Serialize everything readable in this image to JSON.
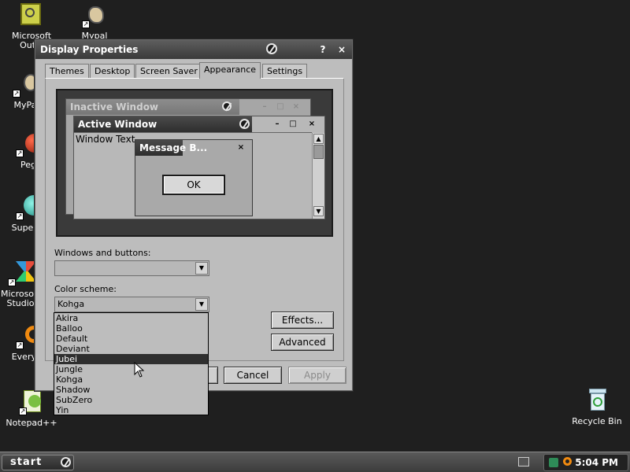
{
  "desktop": {
    "icons": [
      {
        "label": "Microsoft Outlook",
        "label_visible": "Microsoft\nOutlo"
      },
      {
        "label": "Mypal",
        "label_visible": "Mypal"
      },
      {
        "label": "MyPa",
        "label_visible": "MyPa"
      },
      {
        "label": "Peg",
        "label_visible": "Peg"
      },
      {
        "label": "Superm",
        "label_visible": "Superm"
      },
      {
        "label": "Microsoft Studio",
        "label_visible": "Microsoft\nStudio"
      },
      {
        "label": "Everyth",
        "label_visible": "Everyth"
      },
      {
        "label": "Notepad++",
        "label_visible": "Notepad++"
      },
      {
        "label": "Recycle Bin",
        "label_visible": "Recycle Bin"
      }
    ]
  },
  "dialog": {
    "title": "Display Properties",
    "help_label": "?",
    "close_label": "×",
    "tabs": [
      {
        "label": "Themes"
      },
      {
        "label": "Desktop"
      },
      {
        "label": "Screen Saver"
      },
      {
        "label": "Appearance",
        "active": true
      },
      {
        "label": "Settings"
      }
    ],
    "preview": {
      "inactive_title": "Inactive Window",
      "active_title": "Active Window",
      "window_text": "Window Text",
      "message_title": "Message B...",
      "ok_label": "OK"
    },
    "windows_buttons_label": "Windows and buttons:",
    "windows_buttons_value": "",
    "color_scheme_label": "Color scheme:",
    "color_scheme_value": "Kohga",
    "effects_label": "Effects...",
    "advanced_label": "Advanced",
    "cancel_label": "Cancel",
    "apply_label": "Apply",
    "color_scheme_options": [
      "Akira",
      "Balloo",
      "Default",
      "Deviant",
      "Jubei",
      "Jungle",
      "Kohga",
      "Shadow",
      "SubZero",
      "Yin"
    ],
    "highlighted_option": "Jubei"
  },
  "taskbar": {
    "start_label": "start",
    "clock": "5:04 PM"
  }
}
